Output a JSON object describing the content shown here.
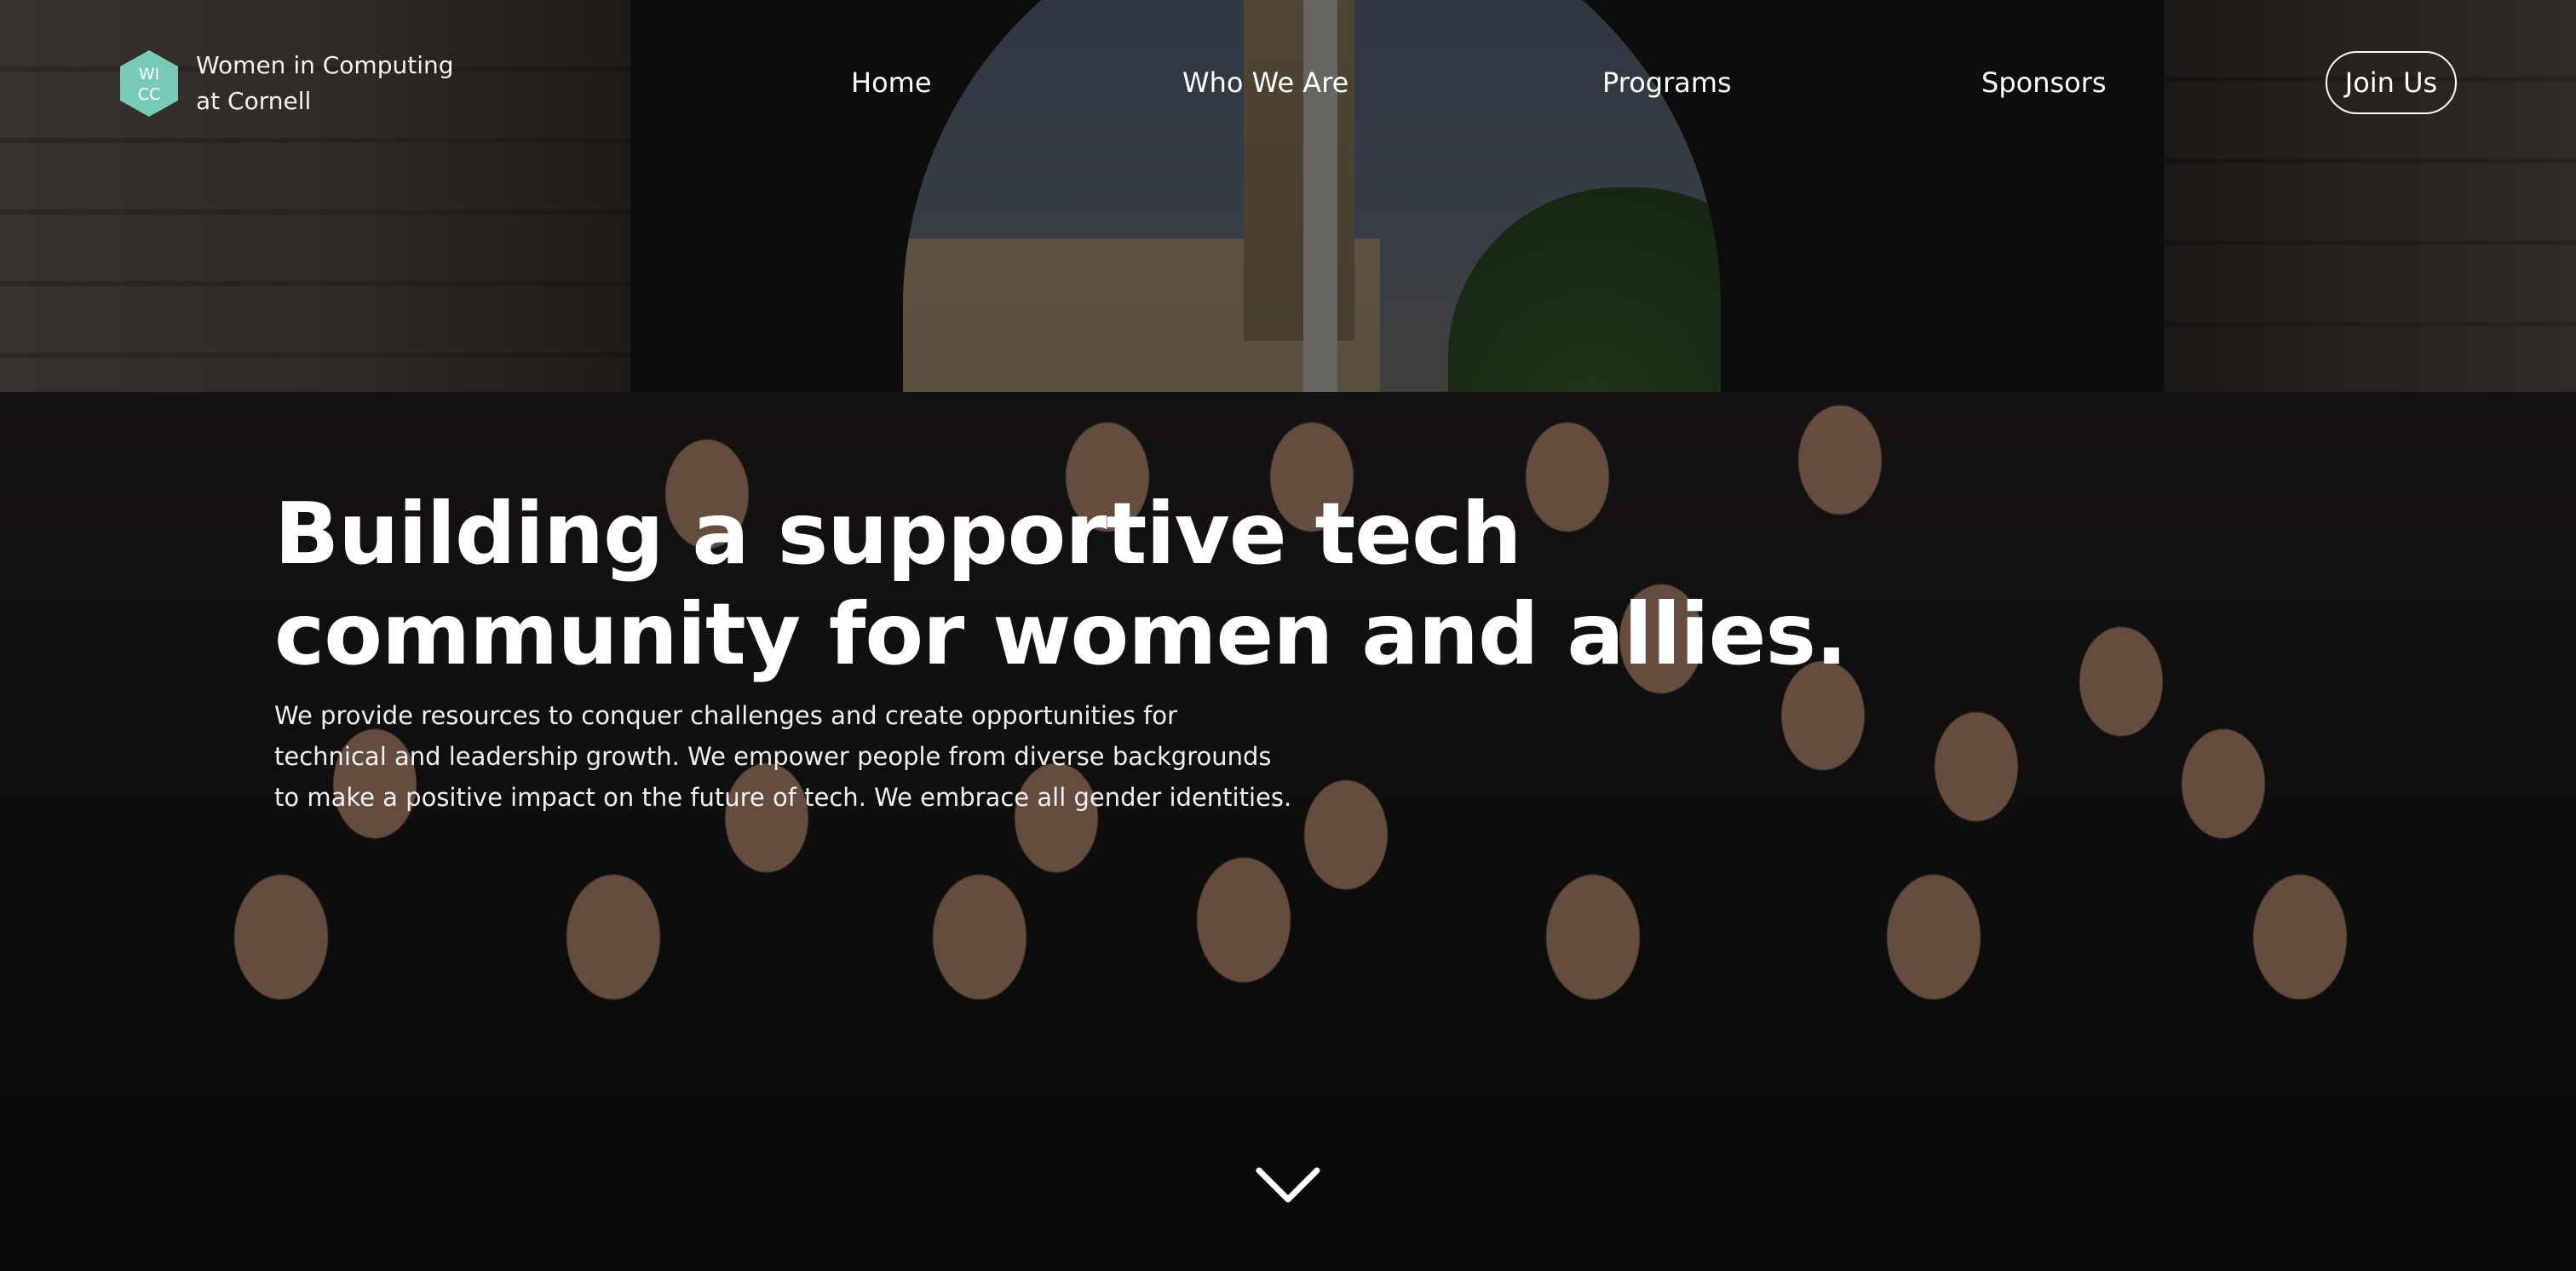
{
  "brand": {
    "logo_letters": [
      "WI",
      "CC"
    ],
    "name_line1": "Women in Computing",
    "name_line2": "at Cornell",
    "logo_color": "#7fdcc9"
  },
  "nav": {
    "items": [
      {
        "label": "Home"
      },
      {
        "label": "Who We Are"
      },
      {
        "label": "Programs"
      },
      {
        "label": "Sponsors"
      }
    ],
    "join_label": "Join Us"
  },
  "hero": {
    "title_lines": [
      "Building a supportive tech",
      "community for women and allies."
    ],
    "description_lines": [
      "We provide resources to conquer challenges and create opportunities for",
      "technical and leadership growth. We empower people from diverse backgrounds",
      "to make a positive impact on the future of tech. We embrace all gender identities."
    ],
    "scroll_icon": "chevron-down-icon"
  },
  "colors": {
    "text": "#ffffff",
    "overlay": "rgba(0,0,0,0.5)"
  }
}
